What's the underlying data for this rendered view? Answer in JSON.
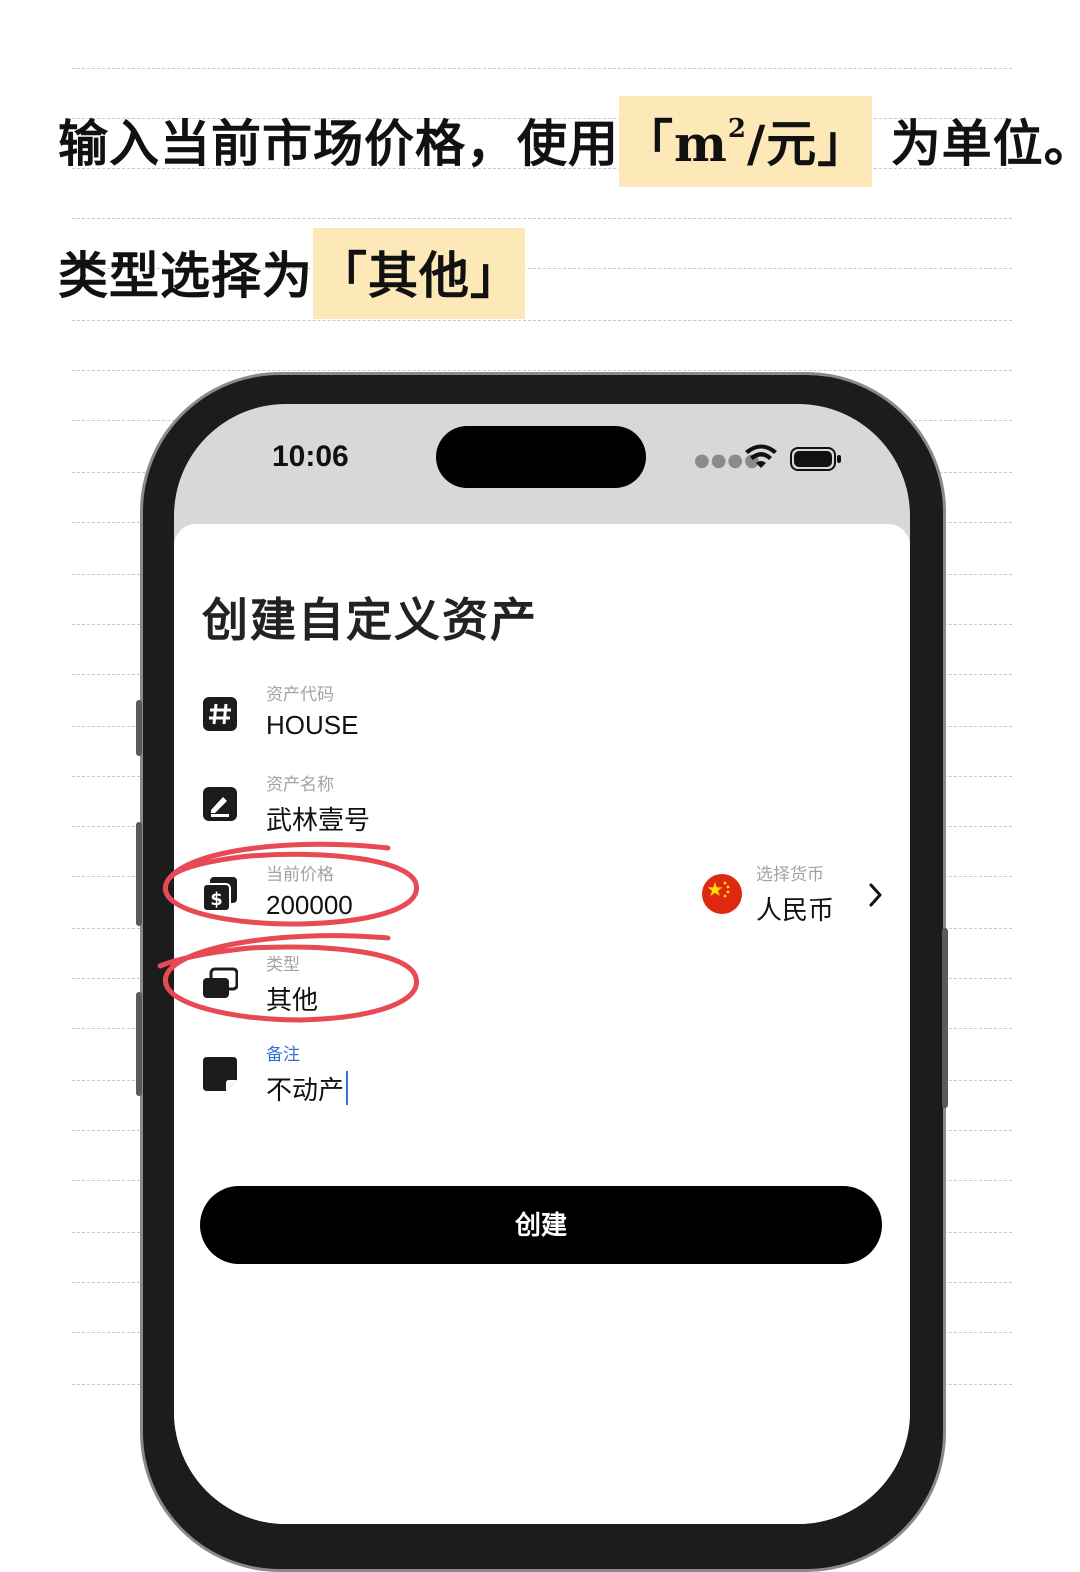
{
  "headline": {
    "line1_prefix": "输入当前市场价格，使用",
    "line1_hl_open": "「m",
    "line1_hl_sup": "2",
    "line1_hl_close": "/元」",
    "line1_suffix": "为单位。",
    "line2_prefix": "类型选择为",
    "line2_hl": "「其他」"
  },
  "status_bar": {
    "time": "10:06"
  },
  "sheet": {
    "title": "创建自定义资产",
    "fields": [
      {
        "label": "资产代码",
        "value": "HOUSE",
        "icon": "hash-icon"
      },
      {
        "label": "资产名称",
        "value": "武林壹号",
        "icon": "edit-icon"
      },
      {
        "label": "当前价格",
        "value": "200000",
        "icon": "money-icon"
      },
      {
        "label": "类型",
        "value": "其他",
        "icon": "cards-icon"
      },
      {
        "label": "备注",
        "value": "不动产",
        "icon": "note-icon"
      }
    ],
    "currency": {
      "label": "选择货币",
      "value": "人民币",
      "icon": "china-flag-icon"
    },
    "create_label": "创建"
  },
  "colors": {
    "highlight": "#fde8b8",
    "annotation_circle": "#e84a55",
    "active_label": "#3d6fd1",
    "button": "#000000"
  }
}
